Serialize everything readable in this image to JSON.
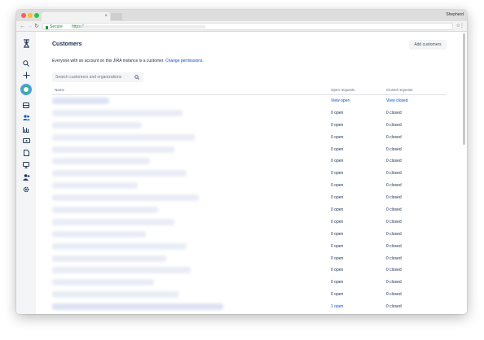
{
  "browser": {
    "profile": "Shepherd",
    "tab_close": "×",
    "secure_label": "Secure",
    "url": "https://"
  },
  "sidebar": {
    "icons": [
      "jira-logo-icon",
      "search-icon",
      "plus-icon",
      "avatar",
      "queues-icon",
      "customers-icon",
      "reports-icon",
      "channels-icon",
      "knowledge-base-icon",
      "feedback-icon",
      "invite-team-icon",
      "settings-icon"
    ]
  },
  "page": {
    "title": "Customers",
    "add_button": "Add customers",
    "info_text": "Everyone with an account on this JIRA instance is a customer.",
    "info_link": "Change permissions.",
    "search_placeholder": "Search customers and organizations"
  },
  "table": {
    "headers": {
      "name": "Name",
      "open": "Open requests",
      "closed": "Closed requests"
    },
    "rows": [
      {
        "open": "View open",
        "closed": "View closed",
        "link": true
      },
      {
        "open": "0 open",
        "closed": "0 closed",
        "link": false
      },
      {
        "open": "0 open",
        "closed": "0 closed",
        "link": false
      },
      {
        "open": "0 open",
        "closed": "0 closed",
        "link": false
      },
      {
        "open": "0 open",
        "closed": "0 closed",
        "link": false
      },
      {
        "open": "0 open",
        "closed": "0 closed",
        "link": false
      },
      {
        "open": "0 open",
        "closed": "0 closed",
        "link": false
      },
      {
        "open": "0 open",
        "closed": "0 closed",
        "link": false
      },
      {
        "open": "0 open",
        "closed": "0 closed",
        "link": false
      },
      {
        "open": "0 open",
        "closed": "0 closed",
        "link": false
      },
      {
        "open": "0 open",
        "closed": "0 closed",
        "link": false
      },
      {
        "open": "0 open",
        "closed": "0 closed",
        "link": false
      },
      {
        "open": "0 open",
        "closed": "0 closed",
        "link": false
      },
      {
        "open": "0 open",
        "closed": "0 closed",
        "link": false
      },
      {
        "open": "0 open",
        "closed": "0 closed",
        "link": false
      },
      {
        "open": "0 open",
        "closed": "0 closed",
        "link": false
      },
      {
        "open": "0 open",
        "closed": "0 closed",
        "link": false
      },
      {
        "open": "1 open",
        "closed": "0 closed",
        "link": false,
        "open_link": true
      }
    ]
  },
  "colors": {
    "accent": "#0052cc",
    "sidebar_bg": "#f4f5f7",
    "text": "#172b4d"
  }
}
